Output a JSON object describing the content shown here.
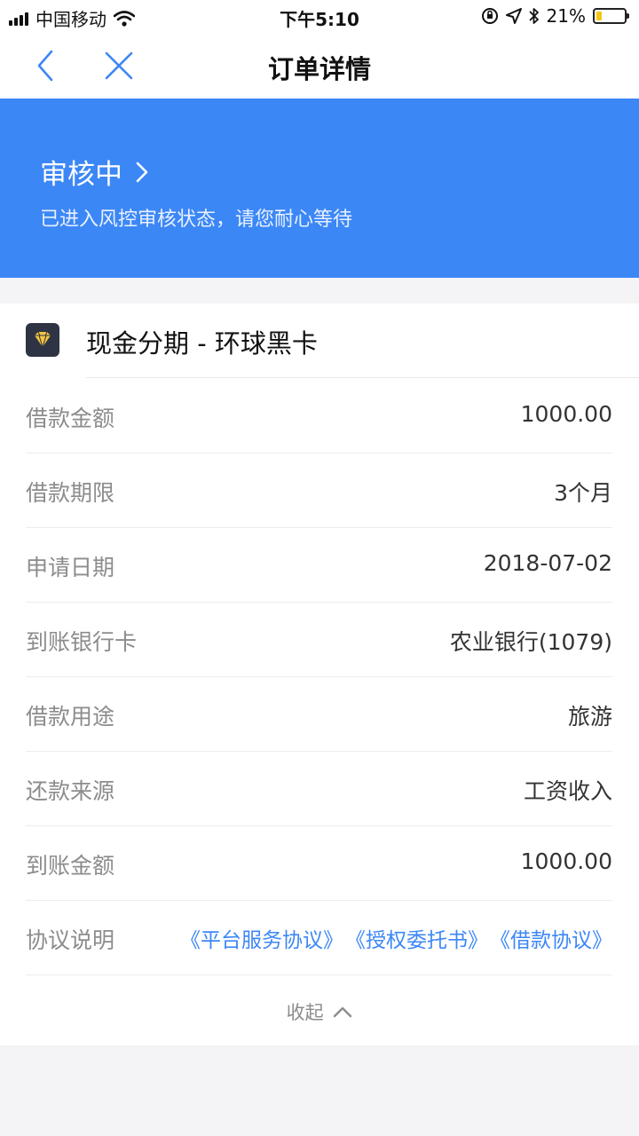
{
  "status_bar": {
    "carrier": "中国移动",
    "time": "下午5:10",
    "battery_percent": "21%",
    "battery_level": 0.21,
    "icons": [
      "signal-icon",
      "wifi-icon",
      "orientation-lock-icon",
      "location-icon",
      "bluetooth-icon",
      "battery-icon"
    ]
  },
  "nav": {
    "title": "订单详情",
    "back_icon": "chevron-left-icon",
    "close_icon": "close-icon"
  },
  "banner": {
    "status": "审核中",
    "description": "已进入风控审核状态，请您耐心等待",
    "color": "#3c87f6"
  },
  "order": {
    "product_name": "现金分期 - 环球黑卡",
    "product_icon": "diamond-icon",
    "rows": [
      {
        "label": "借款金额",
        "value": "1000.00"
      },
      {
        "label": "借款期限",
        "value": "3个月"
      },
      {
        "label": "申请日期",
        "value": "2018-07-02"
      },
      {
        "label": "到账银行卡",
        "value": "农业银行(1079)"
      },
      {
        "label": "借款用途",
        "value": "旅游"
      },
      {
        "label": "还款来源",
        "value": "工资收入"
      },
      {
        "label": "到账金额",
        "value": "1000.00"
      }
    ],
    "agreement_label": "协议说明",
    "agreements": [
      "《平台服务协议》",
      "《授权委托书》",
      "《借款协议》"
    ],
    "collapse_label": "收起"
  }
}
